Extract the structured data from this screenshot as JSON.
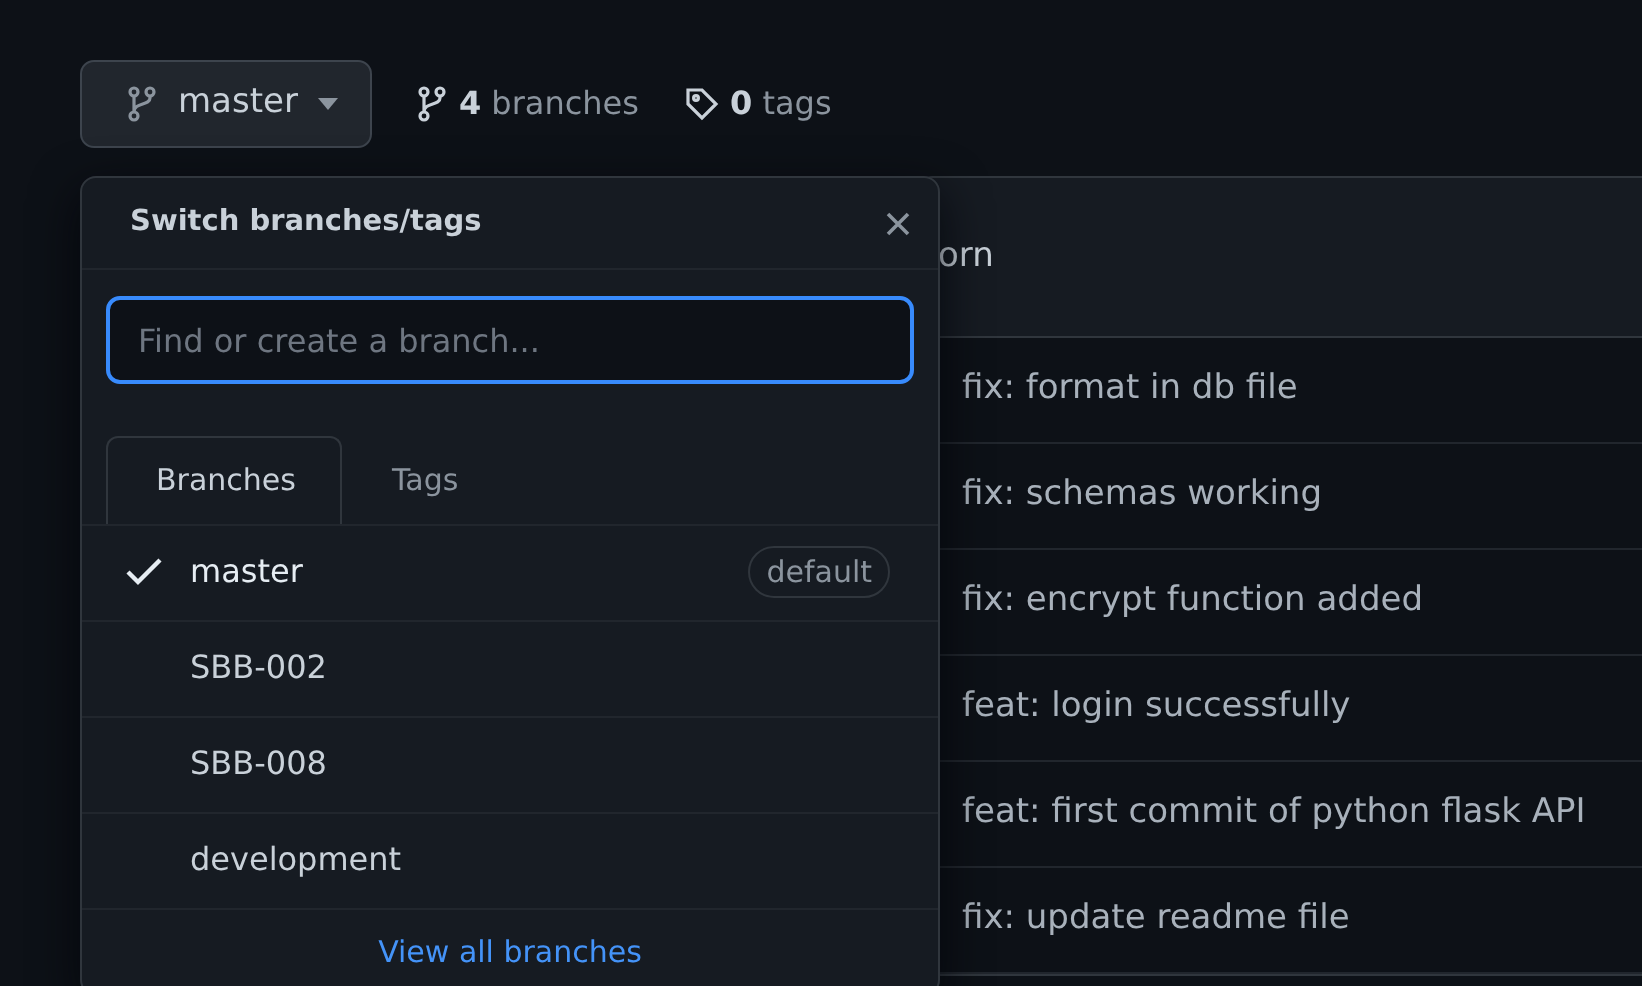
{
  "branch_button": {
    "label": "master"
  },
  "counts": [
    {
      "kind": "branches",
      "number": "4",
      "label": "branches"
    },
    {
      "kind": "tags",
      "number": "0",
      "label": "tags"
    }
  ],
  "dropdown": {
    "title": "Switch branches/tags",
    "search": {
      "placeholder": "Find or create a branch..."
    },
    "tabs": [
      {
        "label": "Branches",
        "selected": true
      },
      {
        "label": "Tags",
        "selected": false
      }
    ],
    "branches": [
      {
        "name": "master",
        "selected": true,
        "badge": "default"
      },
      {
        "name": "SBB-002",
        "selected": false
      },
      {
        "name": "SBB-008",
        "selected": false
      },
      {
        "name": "development",
        "selected": false
      }
    ],
    "footer_link": "View all branches"
  },
  "file_table": {
    "header": "orn",
    "rows": [
      {
        "message": "fix: format in db file"
      },
      {
        "message": "fix: schemas working"
      },
      {
        "message": "fix: encrypt function added"
      },
      {
        "message": "feat: login successfully"
      },
      {
        "message": "feat: first commit of python flask API"
      },
      {
        "message": "fix: update readme file"
      }
    ]
  }
}
